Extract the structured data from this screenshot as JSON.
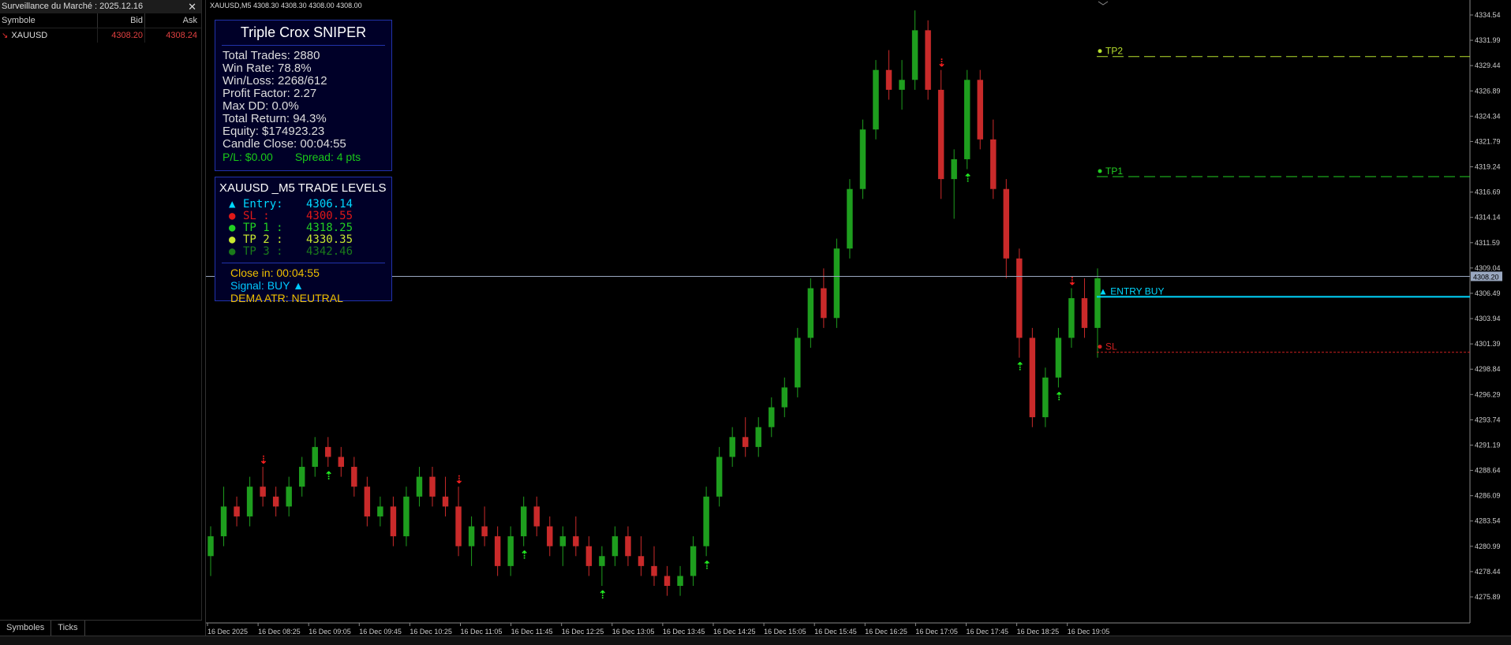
{
  "market_watch": {
    "title": "Surveillance du Marché : 2025.12.16",
    "close_icon": "close-icon",
    "headers": {
      "symbol": "Symbole",
      "bid": "Bid",
      "ask": "Ask"
    },
    "rows": [
      {
        "symbol": "XAUUSD",
        "bid": "4308.20",
        "ask": "4308.24"
      }
    ],
    "tabs": [
      "Symboles",
      "Ticks"
    ]
  },
  "chart": {
    "title": "XAUUSD,M5  4308.30 4308.30 4308.00 4308.00",
    "price_labels": [
      "4334.54",
      "4331.99",
      "4329.44",
      "4326.89",
      "4324.34",
      "4321.79",
      "4319.24",
      "4316.69",
      "4314.14",
      "4311.59",
      "4309.04",
      "4306.49",
      "4303.94",
      "4301.39",
      "4298.84",
      "4296.29",
      "4293.74",
      "4291.19",
      "4288.64",
      "4286.09",
      "4283.54",
      "4280.99",
      "4278.44",
      "4275.89"
    ],
    "current_price_tag": "4308.20",
    "time_labels": [
      "16 Dec 2025",
      "16 Dec 08:25",
      "16 Dec 09:05",
      "16 Dec 09:45",
      "16 Dec 10:25",
      "16 Dec 11:05",
      "16 Dec 11:45",
      "16 Dec 12:25",
      "16 Dec 13:05",
      "16 Dec 13:45",
      "16 Dec 14:25",
      "16 Dec 15:05",
      "16 Dec 15:45",
      "16 Dec 16:25",
      "16 Dec 17:05",
      "16 Dec 17:45",
      "16 Dec 18:25",
      "16 Dec 19:05"
    ],
    "line_labels": {
      "tp2": "TP2",
      "tp1": "TP1",
      "entry": "ENTRY BUY",
      "sl": "SL"
    },
    "colors": {
      "bull": "#1e9e1e",
      "bear": "#c92a2a",
      "entry": "#00d8ff",
      "tp1": "#22d022",
      "tp2": "#b8e02e",
      "sl": "#d02020",
      "up_arrow": "#22ee22",
      "down_arrow": "#ff2020"
    },
    "candles_ohlc": [
      [
        4280,
        4283,
        4278,
        4282
      ],
      [
        4282,
        4287,
        4281,
        4285
      ],
      [
        4285,
        4286,
        4283,
        4284
      ],
      [
        4284,
        4288,
        4283,
        4287
      ],
      [
        4287,
        4289,
        4285,
        4286
      ],
      [
        4286,
        4287,
        4284,
        4285
      ],
      [
        4285,
        4288,
        4284,
        4287
      ],
      [
        4287,
        4290,
        4286,
        4289
      ],
      [
        4289,
        4292,
        4288,
        4291
      ],
      [
        4291,
        4292,
        4289,
        4290
      ],
      [
        4290,
        4291,
        4288,
        4289
      ],
      [
        4289,
        4290,
        4286,
        4287
      ],
      [
        4287,
        4288,
        4283,
        4284
      ],
      [
        4284,
        4286,
        4283,
        4285
      ],
      [
        4285,
        4286,
        4281,
        4282
      ],
      [
        4282,
        4287,
        4281,
        4286
      ],
      [
        4286,
        4289,
        4285,
        4288
      ],
      [
        4288,
        4289,
        4285,
        4286
      ],
      [
        4286,
        4288,
        4284,
        4285
      ],
      [
        4285,
        4287,
        4280,
        4281
      ],
      [
        4281,
        4284,
        4279,
        4283
      ],
      [
        4283,
        4285,
        4281,
        4282
      ],
      [
        4282,
        4283,
        4278,
        4279
      ],
      [
        4279,
        4283,
        4278,
        4282
      ],
      [
        4282,
        4286,
        4281,
        4285
      ],
      [
        4285,
        4286,
        4282,
        4283
      ],
      [
        4283,
        4284,
        4280,
        4281
      ],
      [
        4281,
        4283,
        4279,
        4282
      ],
      [
        4282,
        4284,
        4280,
        4281
      ],
      [
        4281,
        4282,
        4278,
        4279
      ],
      [
        4279,
        4281,
        4277,
        4280
      ],
      [
        4280,
        4283,
        4279,
        4282
      ],
      [
        4282,
        4283,
        4279,
        4280
      ],
      [
        4280,
        4282,
        4278,
        4279
      ],
      [
        4279,
        4281,
        4277,
        4278
      ],
      [
        4278,
        4279,
        4276,
        4277
      ],
      [
        4277,
        4279,
        4276,
        4278
      ],
      [
        4278,
        4282,
        4277,
        4281
      ],
      [
        4281,
        4287,
        4280,
        4286
      ],
      [
        4286,
        4291,
        4285,
        4290
      ],
      [
        4290,
        4293,
        4289,
        4292
      ],
      [
        4292,
        4294,
        4290,
        4291
      ],
      [
        4291,
        4294,
        4290,
        4293
      ],
      [
        4293,
        4296,
        4292,
        4295
      ],
      [
        4295,
        4298,
        4294,
        4297
      ],
      [
        4297,
        4303,
        4296,
        4302
      ],
      [
        4302,
        4308,
        4301,
        4307
      ],
      [
        4307,
        4309,
        4303,
        4304
      ],
      [
        4304,
        4312,
        4303,
        4311
      ],
      [
        4311,
        4318,
        4310,
        4317
      ],
      [
        4317,
        4324,
        4316,
        4323
      ],
      [
        4323,
        4330,
        4322,
        4329
      ],
      [
        4329,
        4331,
        4326,
        4327
      ],
      [
        4327,
        4330,
        4325,
        4328
      ],
      [
        4328,
        4335,
        4327,
        4333
      ],
      [
        4333,
        4334,
        4326,
        4327
      ],
      [
        4327,
        4329,
        4316,
        4318
      ],
      [
        4318,
        4321,
        4314,
        4320
      ],
      [
        4320,
        4329,
        4319,
        4328
      ],
      [
        4328,
        4329,
        4321,
        4322
      ],
      [
        4322,
        4324,
        4316,
        4317
      ],
      [
        4317,
        4318,
        4308,
        4310
      ],
      [
        4310,
        4311,
        4300,
        4302
      ],
      [
        4302,
        4303,
        4293,
        4294
      ],
      [
        4294,
        4299,
        4293,
        4298
      ],
      [
        4298,
        4303,
        4297,
        4302
      ],
      [
        4302,
        4307,
        4301,
        4306
      ],
      [
        4306,
        4308,
        4302,
        4303
      ],
      [
        4303,
        4309,
        4300,
        4308
      ]
    ]
  },
  "info_panel": {
    "title": "Triple Crox SNIPER",
    "lines": [
      "Total Trades: 2880",
      "Win Rate: 78.8%",
      "Win/Loss: 2268/612",
      "Profit Factor: 2.27",
      "Max DD: 0.0%",
      "Total Return: 94.3%",
      "Equity: $174923.23",
      "Candle Close: 00:04:55"
    ],
    "pl": "P/L: $0.00",
    "spread": "Spread: 4 pts"
  },
  "levels_panel": {
    "title": "XAUUSD _M5  TRADE LEVELS",
    "levels": [
      {
        "bullet": "▲",
        "name": "Entry:",
        "value": "4306.14",
        "color": "#00d8ff"
      },
      {
        "bullet": "●",
        "name": "SL   :",
        "value": "4300.55",
        "color": "#e01818"
      },
      {
        "bullet": "●",
        "name": "TP 1 :",
        "value": "4318.25",
        "color": "#22d022"
      },
      {
        "bullet": "●",
        "name": "TP 2 :",
        "value": "4330.35",
        "color": "#c8e830"
      },
      {
        "bullet": "●",
        "name": "TP 3 :",
        "value": "4342.46",
        "color": "#1a7a1a"
      }
    ],
    "close_in": "Close in: 00:04:55",
    "signal": "Signal: BUY ▲",
    "dema": "DEMA ATR: NEUTRAL"
  }
}
